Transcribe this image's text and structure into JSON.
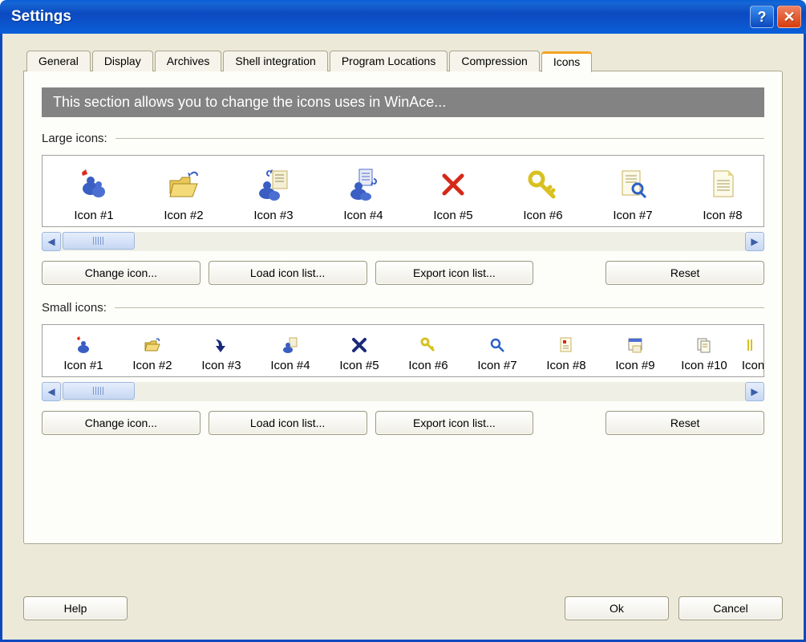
{
  "window": {
    "title": "Settings"
  },
  "tabs": [
    "General",
    "Display",
    "Archives",
    "Shell integration",
    "Program Locations",
    "Compression",
    "Icons"
  ],
  "active_tab": 6,
  "description": "This section allows you to change the icons uses in WinAce...",
  "large_section": {
    "label": "Large icons:",
    "items": [
      {
        "label": "Icon #1",
        "icon": "people-star"
      },
      {
        "label": "Icon #2",
        "icon": "folder-open"
      },
      {
        "label": "Icon #3",
        "icon": "people-doc"
      },
      {
        "label": "Icon #4",
        "icon": "people-list"
      },
      {
        "label": "Icon #5",
        "icon": "red-x"
      },
      {
        "label": "Icon #6",
        "icon": "key"
      },
      {
        "label": "Icon #7",
        "icon": "doc-magnify"
      },
      {
        "label": "Icon #8",
        "icon": "doc-lines"
      }
    ],
    "buttons": {
      "change": "Change icon...",
      "load": "Load icon list...",
      "export": "Export icon list...",
      "reset": "Reset"
    }
  },
  "small_section": {
    "label": "Small icons:",
    "items": [
      {
        "label": "Icon #1",
        "icon": "people-star-sm"
      },
      {
        "label": "Icon #2",
        "icon": "folder-sm"
      },
      {
        "label": "Icon #3",
        "icon": "arrow-down"
      },
      {
        "label": "Icon #4",
        "icon": "people-sm"
      },
      {
        "label": "Icon #5",
        "icon": "blue-x"
      },
      {
        "label": "Icon #6",
        "icon": "key-sm"
      },
      {
        "label": "Icon #7",
        "icon": "magnify"
      },
      {
        "label": "Icon #8",
        "icon": "doc-red"
      },
      {
        "label": "Icon #9",
        "icon": "app-window"
      },
      {
        "label": "Icon #10",
        "icon": "docs"
      },
      {
        "label": "Icon",
        "icon": "partial"
      }
    ],
    "buttons": {
      "change": "Change icon...",
      "load": "Load icon list...",
      "export": "Export icon list...",
      "reset": "Reset"
    }
  },
  "dlg": {
    "help": "Help",
    "ok": "Ok",
    "cancel": "Cancel"
  }
}
